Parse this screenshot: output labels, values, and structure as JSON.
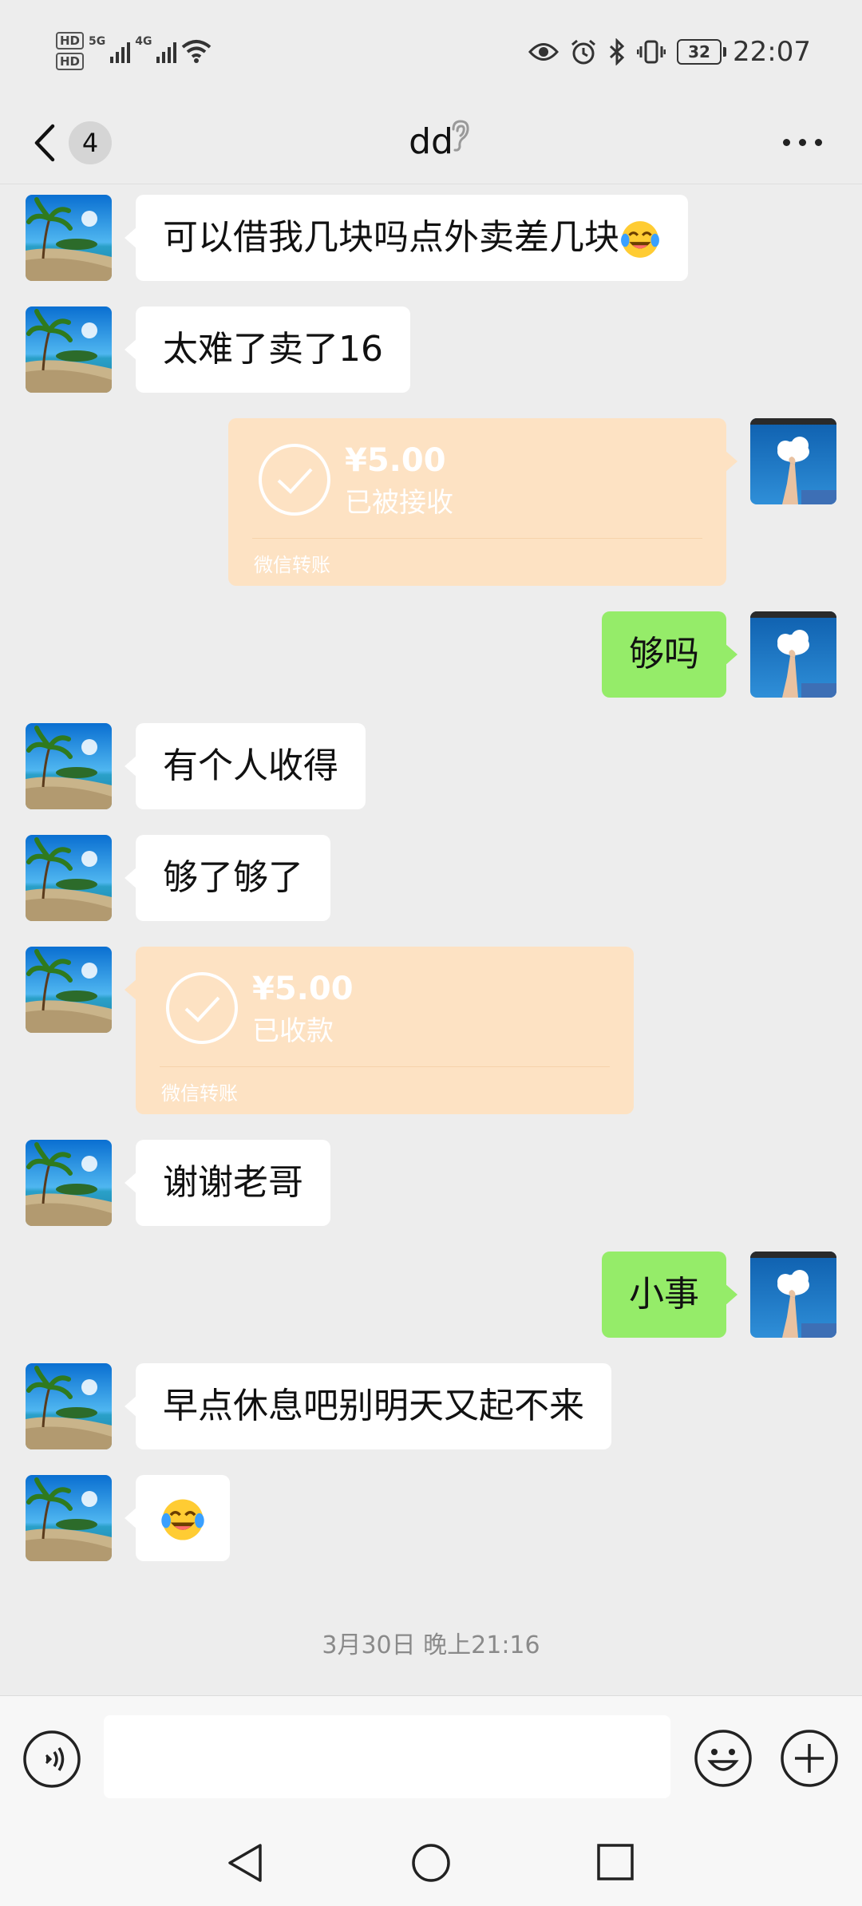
{
  "status_bar": {
    "hd1": "HD",
    "hd2": "HD",
    "net1": "5G",
    "net2": "4G",
    "battery": "32",
    "time": "22:07"
  },
  "nav": {
    "unread_count": "4",
    "title": "dd"
  },
  "messages": [
    {
      "side": "left",
      "type": "text",
      "text": "可以借我几块吗点外卖差几块"
    },
    {
      "side": "left",
      "type": "text",
      "text": "太难了卖了16"
    },
    {
      "side": "right",
      "type": "transfer",
      "amount": "¥5.00",
      "status": "已被接收",
      "label": "微信转账"
    },
    {
      "side": "right",
      "type": "text",
      "text": "够吗"
    },
    {
      "side": "left",
      "type": "text",
      "text": "有个人收得"
    },
    {
      "side": "left",
      "type": "text",
      "text": "够了够了"
    },
    {
      "side": "left",
      "type": "transfer",
      "amount": "¥5.00",
      "status": "已收款",
      "label": "微信转账"
    },
    {
      "side": "left",
      "type": "text",
      "text": "谢谢老哥"
    },
    {
      "side": "right",
      "type": "text",
      "text": "小事"
    },
    {
      "side": "left",
      "type": "text",
      "text": "早点休息吧别明天又起不来"
    },
    {
      "side": "left",
      "type": "emoji",
      "text": ""
    }
  ],
  "timestamp": "3月30日 晚上21:16",
  "colors": {
    "background": "#ededed",
    "self_bubble": "#95ec69",
    "other_bubble": "#ffffff",
    "transfer_card": "#fde2c3"
  }
}
